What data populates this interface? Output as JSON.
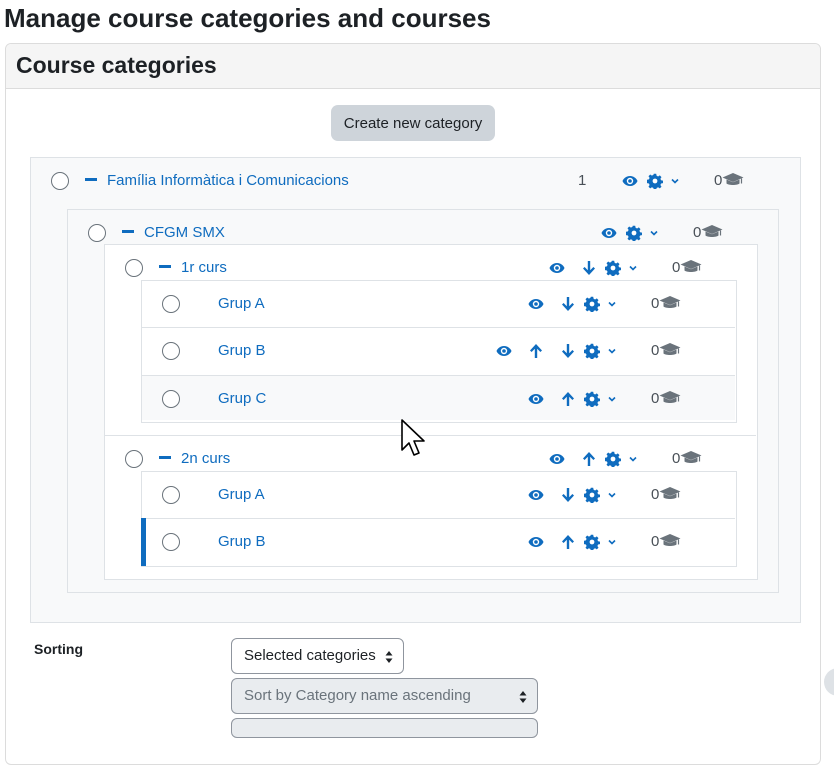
{
  "page": {
    "title": "Manage course categories and courses"
  },
  "card": {
    "title": "Course categories"
  },
  "actions": {
    "create_category": "Create new category"
  },
  "categories": [
    {
      "name": "Família Informàtica i Comunicacions",
      "level": 0,
      "subcategory_count": "1",
      "course_count": "0",
      "actions": [
        "show",
        "settings"
      ]
    },
    {
      "name": "CFGM SMX",
      "level": 1,
      "subcategory_count": "",
      "course_count": "0",
      "actions": [
        "show",
        "settings"
      ]
    },
    {
      "name": "1r curs",
      "level": 2,
      "subcategory_count": "",
      "course_count": "0",
      "actions": [
        "show",
        "move-down",
        "settings"
      ]
    },
    {
      "name": "Grup A",
      "level": 3,
      "subcategory_count": "",
      "course_count": "0",
      "actions": [
        "show",
        "move-down",
        "settings"
      ]
    },
    {
      "name": "Grup B",
      "level": 3,
      "subcategory_count": "",
      "course_count": "0",
      "actions": [
        "show",
        "move-up",
        "move-down",
        "settings"
      ]
    },
    {
      "name": "Grup C",
      "level": 3,
      "subcategory_count": "",
      "course_count": "0",
      "actions": [
        "show",
        "move-up",
        "settings"
      ]
    },
    {
      "name": "2n curs",
      "level": 2,
      "subcategory_count": "",
      "course_count": "0",
      "actions": [
        "show",
        "move-up",
        "settings"
      ]
    },
    {
      "name": "Grup A",
      "level": 3,
      "subcategory_count": "",
      "course_count": "0",
      "actions": [
        "show",
        "move-down",
        "settings"
      ]
    },
    {
      "name": "Grup B",
      "level": 3,
      "subcategory_count": "",
      "course_count": "0",
      "actions": [
        "show",
        "move-up",
        "settings"
      ],
      "selected": true
    }
  ],
  "sorting": {
    "label": "Sorting",
    "scope": "Selected categories",
    "sort_by": "Sort by Category name ascending"
  },
  "icons": {
    "eye": "eye-icon",
    "arrow_up": "arrow-up-icon",
    "arrow_down": "arrow-down-icon",
    "gear": "gear-icon",
    "caret": "chevron-down-icon",
    "courses": "graduation-cap-icon",
    "collapse": "minus-icon"
  },
  "colors": {
    "link": "#0f6cbf",
    "button_bg": "#ced4da",
    "panel_bg": "#f8f9fa",
    "selected_bar": "#0f6cbf"
  }
}
